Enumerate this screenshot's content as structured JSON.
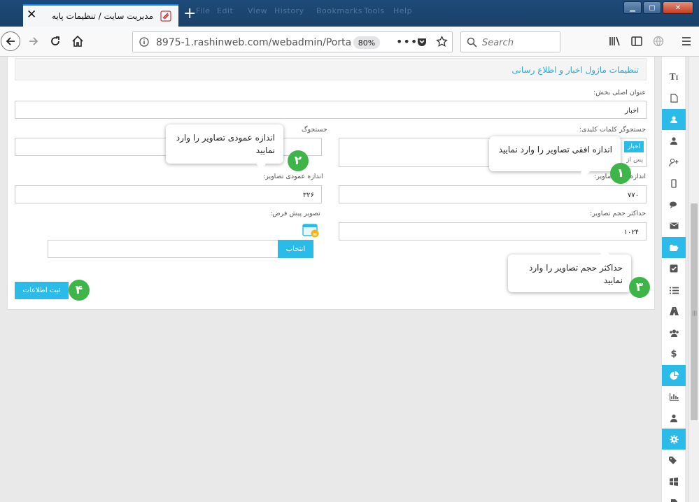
{
  "browser": {
    "ghost_menu": [
      "File",
      "Edit",
      "View",
      "History",
      "Bookmarks",
      "Tools",
      "Help"
    ],
    "tab_title": "مدیریت سایت / تنظیمات پایه",
    "url": "8975-1.rashinweb.com/webadmin/Porta",
    "zoom": "80%",
    "search_placeholder": "Search"
  },
  "page": {
    "section_title": "تنظیمات ماژول اخبار و اطلاع رسانی",
    "main_title_label": "عنوان اصلی بخش:",
    "main_title_value": "اخبار",
    "keyword_search_label": "جستجوگر کلمات کلیدی:",
    "keyword_tag": "اخبار",
    "keyword_after_text": "پس از",
    "search_label_left": "جستجوگ",
    "horizontal_label": "اندازه افقی تصاویر:",
    "horizontal_label_visible": "اندازه",
    "horizontal_label_tail": "تصاویر:",
    "horizontal_value": "۷۷۰",
    "vertical_label": "اندازه عمودی تصاویر:",
    "vertical_value": "۳۲۶",
    "max_size_label": "حداکثر حجم تصاویر:",
    "max_size_value": "۱۰۲۴",
    "default_image_label": "تصویر پیش فرض:",
    "choose_button": "انتخاب",
    "submit_button": "ثبت اطلاعات"
  },
  "callouts": {
    "c1_text": "اندازه افقی تصاویر  را وارد نمایید",
    "c1_num": "۱",
    "c2_text": "اندازه عمودی تصاویر را وارد نمایید",
    "c2_num": "۲",
    "c3_text": "حداکثر حجم تصاویر را وارد نمایید",
    "c3_num": "۳",
    "c4_num": "۴"
  },
  "sidebar_icons": [
    "text-icon",
    "page-icon",
    "users-group-icon",
    "user-icon",
    "user-add-icon",
    "mobile-icon",
    "comments-icon",
    "mail-icon",
    "folder-open-icon",
    "checkbox-icon",
    "list-icon",
    "road-icon",
    "group-icon",
    "dollar-icon",
    "pie-chart-icon",
    "bar-chart-icon",
    "user-tie-icon",
    "gear-icon",
    "tags-icon",
    "windows-icon"
  ],
  "colors": {
    "accent": "#2bbbe8",
    "badge": "#3fb549",
    "titlebar": "#1d4a78"
  }
}
